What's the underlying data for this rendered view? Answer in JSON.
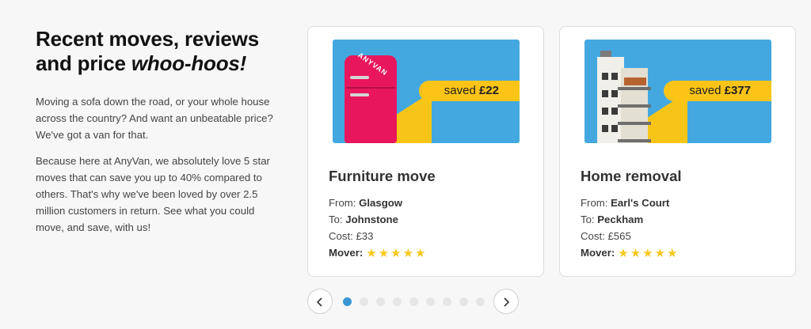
{
  "intro": {
    "heading_line1": "Recent moves, reviews",
    "heading_line2_prefix": "and price ",
    "heading_line2_emph": "whoo-hoos!",
    "para1": "Moving a sofa down the road, or your whole house across the country? And want an unbeatable price? We've got a van for that.",
    "para2": "Because here at AnyVan, we absolutely love 5 star moves that can save you up to 40% compared to others. That's why we've been loved by over 2.5 million customers in return. See what you could move, and save, with us!"
  },
  "cards": [
    {
      "badge_prefix": "saved ",
      "badge_amount": "£22",
      "image_icon": "fridge-illustration",
      "fridge_logo": "ANYVAN",
      "title": "Furniture move",
      "from_label": "From: ",
      "from_value": "Glasgow",
      "to_label": "To: ",
      "to_value": "Johnstone",
      "cost_label": "Cost: ",
      "cost_value": "£33",
      "mover_label": "Mover:",
      "rating": 5
    },
    {
      "badge_prefix": "saved ",
      "badge_amount": "£377",
      "image_icon": "building-illustration",
      "title": "Home removal",
      "from_label": "From: ",
      "from_value": "Earl's Court",
      "to_label": "To: ",
      "to_value": "Peckham",
      "cost_label": "Cost: ",
      "cost_value": "£565",
      "mover_label": "Mover:",
      "rating": 5
    }
  ],
  "pager": {
    "prev_icon": "chevron-left-icon",
    "next_icon": "chevron-right-icon",
    "total_pages": 9,
    "active_page": 1
  },
  "colors": {
    "image_bg": "#43a8e0",
    "badge": "#fcc417",
    "star": "#f9c81c",
    "active_dot": "#3b97d3"
  }
}
